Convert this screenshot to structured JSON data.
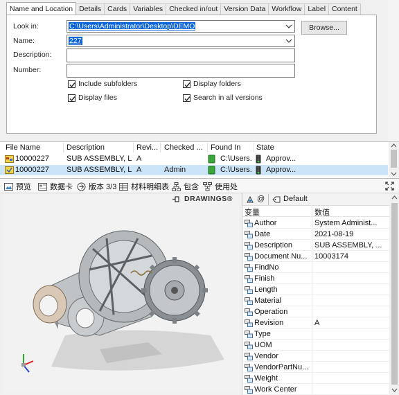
{
  "search": {
    "tabs": [
      "Name and Location",
      "Details",
      "Cards",
      "Variables",
      "Checked in/out",
      "Version Data",
      "Workflow",
      "Label",
      "Content"
    ],
    "look_in_label": "Look in:",
    "look_in_value": "C:\\Users\\Administrator\\Desktop\\DEMO",
    "name_label": "Name:",
    "name_value": "227",
    "description_label": "Description:",
    "number_label": "Number:",
    "browse_label": "Browse...",
    "options": {
      "include_subfolders": "Include subfolders",
      "display_folders": "Display folders",
      "display_files": "Display files",
      "search_all_versions": "Search in all versions"
    }
  },
  "results": {
    "columns": [
      "File Name",
      "Description",
      "Revi...",
      "Checked ...",
      "Found In",
      "State"
    ],
    "rows": [
      {
        "file": "10000227",
        "description": "SUB ASSEMBLY, LH...",
        "revision": "A",
        "checked": "",
        "found_in": "C:\\Users...",
        "state": "Approv..."
      },
      {
        "file": "10000227",
        "description": "SUB ASSEMBLY, LH...",
        "revision": "A",
        "checked": "Admin",
        "found_in": "C:\\Users...",
        "state": "Approv..."
      }
    ]
  },
  "preview_tabs": [
    "预览",
    "数据卡",
    "版本 3/3",
    "材料明细表",
    "包含",
    "使用处"
  ],
  "preview": {
    "logo": "DRAWINGS®"
  },
  "properties": {
    "config_label": "@",
    "config_name": "Default",
    "col_variable": "变量",
    "col_value": "数值",
    "rows": [
      {
        "name": "Author",
        "value": "System Administ..."
      },
      {
        "name": "Date",
        "value": "2021-08-19"
      },
      {
        "name": "Description",
        "value": "SUB ASSEMBLY, ..."
      },
      {
        "name": "Document Nu...",
        "value": "10003174"
      },
      {
        "name": "FindNo",
        "value": ""
      },
      {
        "name": "Finish",
        "value": ""
      },
      {
        "name": "Length",
        "value": ""
      },
      {
        "name": "Material",
        "value": ""
      },
      {
        "name": "Operation",
        "value": ""
      },
      {
        "name": "Revision",
        "value": "A"
      },
      {
        "name": "Type",
        "value": ""
      },
      {
        "name": "UOM",
        "value": ""
      },
      {
        "name": "Vendor",
        "value": ""
      },
      {
        "name": "VendorPartNu...",
        "value": ""
      },
      {
        "name": "Weight",
        "value": ""
      },
      {
        "name": "Work Center",
        "value": ""
      }
    ]
  },
  "colors": {
    "selection": "#0a64d8",
    "row_selected": "#cce4f7",
    "state_green": "#2e8b2e",
    "folder_green": "#3aa53a"
  }
}
